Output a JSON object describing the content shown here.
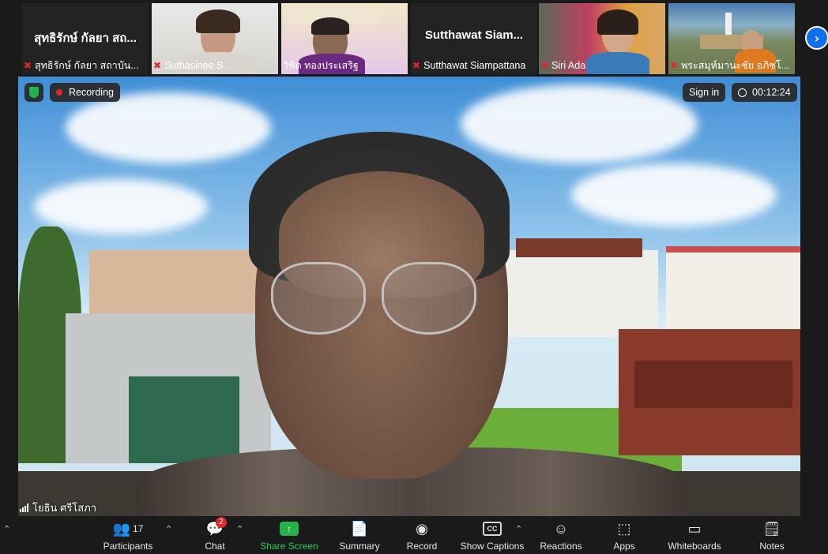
{
  "thumbnails": [
    {
      "name_display": "สุทธิรักษ์ กัลยา สถ...",
      "label": "สุทธิรักษ์ กัลยา สถาบัน...",
      "mic_muted": true,
      "video": false
    },
    {
      "label": "Suthasinee S.",
      "mic_muted": true,
      "video": true
    },
    {
      "label": "วิชิต ทองประเสริฐ",
      "mic_muted": false,
      "video": true
    },
    {
      "name_display": "Sutthawat Siam...",
      "label": "Sutthawat Siampattana",
      "mic_muted": true,
      "video": false
    },
    {
      "label": "Siri Ada",
      "mic_muted": true,
      "video": true
    },
    {
      "label": "พระสมุห์มานะชัย อภิชโ...",
      "mic_muted": true,
      "video": true
    }
  ],
  "stage": {
    "recording_label": "Recording",
    "sign_in_label": "Sign in",
    "timer": "00:12:24",
    "active_speaker": "โยธิน ศรีโสภา"
  },
  "toolbar": {
    "participants_label": "Participants",
    "participants_count": "17",
    "chat_label": "Chat",
    "chat_badge": "2",
    "share_label": "Share Screen",
    "summary_label": "Summary",
    "record_label": "Record",
    "captions_label": "Show Captions",
    "captions_icon": "CC",
    "reactions_label": "Reactions",
    "apps_label": "Apps",
    "whiteboards_label": "Whiteboards",
    "notes_label": "Notes"
  },
  "colors": {
    "accent_blue": "#0e71eb",
    "mute_red": "#e02828",
    "share_green": "#24b24c",
    "toolbar_bg": "#1a1a1a"
  }
}
